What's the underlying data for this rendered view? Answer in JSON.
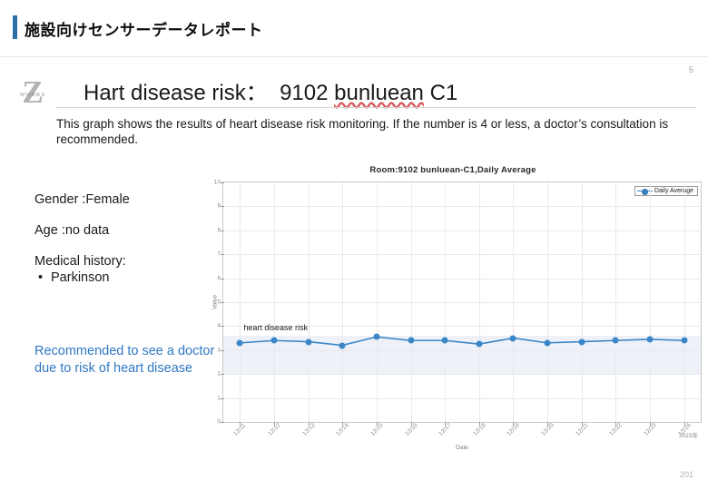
{
  "header": {
    "title": "施設向けセンサーデータレポート"
  },
  "logo": {
    "mark": "Z",
    "wordmark": "WORKS"
  },
  "title": {
    "prefix": "Hart disease risk：",
    "room_number": "9102",
    "room_name": "bunluean",
    "room_suffix": "C1",
    "full": "Hart disease risk： 9102 bunluean C1",
    "slide_number": "5"
  },
  "description": {
    "text": "This graph shows the results of heart disease risk monitoring. If the number is 4 or less, a doctor’s consultation is recommended."
  },
  "patient": {
    "gender": "Gender :Female",
    "age": "Age :no data",
    "medical_history_label": "Medical history:",
    "medical_history_items": [
      "Parkinson"
    ],
    "bullet_glyph": "•",
    "recommendation": "Recommended to see a doctor due to risk of heart disease",
    "recommendation_color": "#2f79c4"
  },
  "chart_data": {
    "type": "line",
    "title": "Room:9102 bunluean-C1,Daily Average",
    "xlabel": "Date",
    "ylabel": "Value",
    "ylim": [
      0,
      10
    ],
    "ytick_values": [
      0,
      1,
      2,
      3,
      4,
      5,
      6,
      7,
      8,
      9,
      10
    ],
    "ytick_labels": [
      "0",
      "1",
      "2",
      "3",
      "4",
      "5",
      "6",
      "7",
      "8",
      "9",
      "10"
    ],
    "categories": [
      "12/11",
      "12/12",
      "12/13",
      "12/14",
      "12/15",
      "12/16",
      "12/17",
      "12/18",
      "12/19",
      "12/20",
      "12/21",
      "12/22",
      "12/23",
      "12/24"
    ],
    "series": [
      {
        "name": "Daily Average",
        "color": "#3a86c8",
        "marker": "circle",
        "values": [
          3.3,
          3.4,
          3.35,
          3.2,
          3.55,
          3.4,
          3.4,
          3.25,
          3.5,
          3.3,
          3.35,
          3.4,
          3.45,
          3.4
        ]
      }
    ],
    "legend": {
      "position": "top-right",
      "entries": [
        "Daily Average"
      ]
    },
    "grid": true,
    "annotations": [
      {
        "text": "heart disease risk",
        "x_index": 0,
        "y": 3.9
      }
    ],
    "shaded_band": {
      "y_from": 2.0,
      "y_to": 3.6,
      "color": "#eef2f8"
    },
    "year_note": "2023年"
  },
  "footer": {
    "page_number": "201"
  }
}
